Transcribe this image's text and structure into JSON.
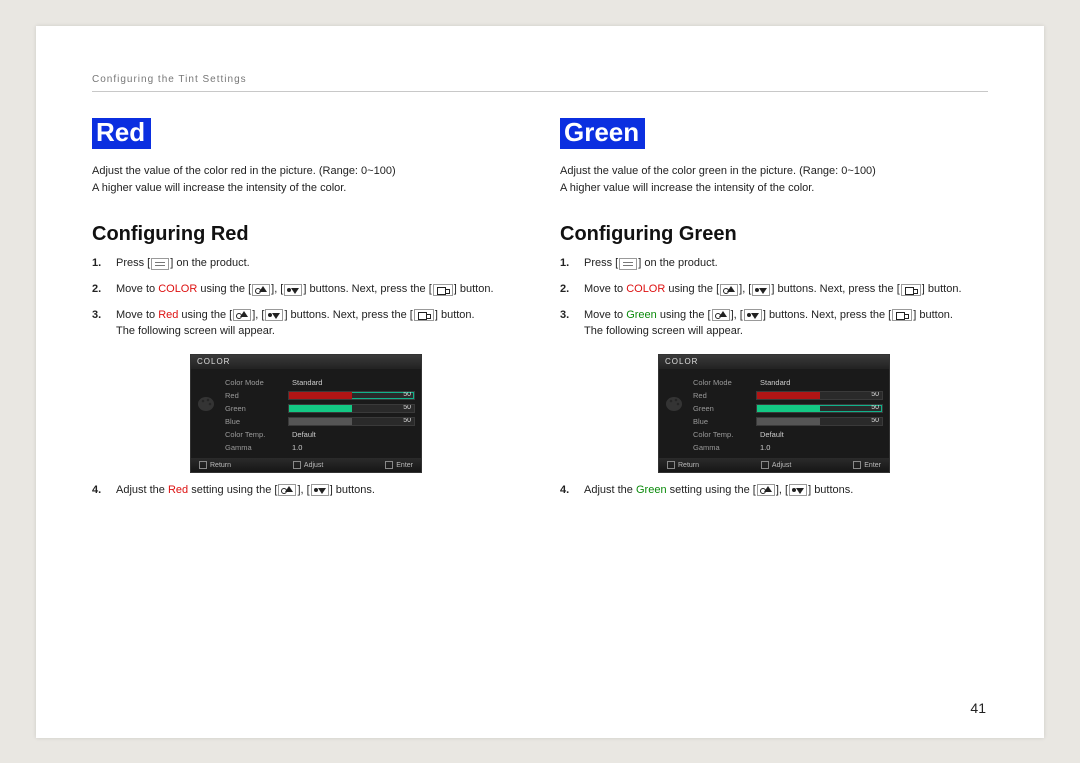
{
  "breadcrumb": "Configuring the Tint Settings",
  "page_number": "41",
  "buttons_text": {
    "on_product": "on the product.",
    "using_buttons": "buttons. Next, press the",
    "button_period": "button."
  },
  "left": {
    "heading": "Red",
    "desc1": "Adjust the value of the color red in the picture. (Range: 0~100)",
    "desc2": "A higher value will increase the intensity of the color.",
    "subhead": "Configuring Red",
    "step1_num": "1.",
    "step1_a": "Press [",
    "step1_b": "] on the product.",
    "step2_num": "2.",
    "step2_a": "Move to ",
    "step2_word": "COLOR",
    "step2_b": " using the [",
    "step2_c": "], [",
    "step2_d": "] buttons. Next, press the [",
    "step2_e": "] button.",
    "step3_num": "3.",
    "step3_a": "Move to ",
    "step3_word": "Red",
    "step3_b": " using the [",
    "step3_c": "], [",
    "step3_d": "] buttons. Next, press the [",
    "step3_e": "] button.",
    "step3_tail": "The following screen will appear.",
    "step4_num": "4.",
    "step4_a": "Adjust the ",
    "step4_word": "Red",
    "step4_b": " setting using the [",
    "step4_c": "], [",
    "step4_d": "] buttons.",
    "osd": {
      "title": "COLOR",
      "rows": [
        "Color Mode",
        "Red",
        "Green",
        "Blue",
        "Color Temp.",
        "Gamma"
      ],
      "vals": {
        "mode": "Standard",
        "temp": "Default",
        "gamma": "1.0"
      },
      "sliders": {
        "red": 50,
        "green": 50,
        "blue": 50
      },
      "highlight": "red",
      "footer": [
        "Return",
        "Adjust",
        "Enter"
      ]
    }
  },
  "right": {
    "heading": "Green",
    "desc1": "Adjust the value of the color green in the picture. (Range: 0~100)",
    "desc2": "A higher value will increase the intensity of the color.",
    "subhead": "Configuring Green",
    "step1_num": "1.",
    "step1_a": "Press [",
    "step1_b": "] on the product.",
    "step2_num": "2.",
    "step2_a": "Move to ",
    "step2_word": "COLOR",
    "step2_b": " using the [",
    "step2_c": "], [",
    "step2_d": "] buttons. Next, press the [",
    "step2_e": "] button.",
    "step3_num": "3.",
    "step3_a": "Move to ",
    "step3_word": "Green",
    "step3_b": " using the [",
    "step3_c": "], [",
    "step3_d": "] buttons. Next, press the [",
    "step3_e": "] button.",
    "step3_tail": "The following screen will appear.",
    "step4_num": "4.",
    "step4_a": "Adjust the ",
    "step4_word": "Green",
    "step4_b": " setting using the [",
    "step4_c": "], [",
    "step4_d": "] buttons.",
    "osd": {
      "title": "COLOR",
      "rows": [
        "Color Mode",
        "Red",
        "Green",
        "Blue",
        "Color Temp.",
        "Gamma"
      ],
      "vals": {
        "mode": "Standard",
        "temp": "Default",
        "gamma": "1.0"
      },
      "sliders": {
        "red": 50,
        "green": 50,
        "blue": 50
      },
      "highlight": "green",
      "footer": [
        "Return",
        "Adjust",
        "Enter"
      ]
    }
  }
}
